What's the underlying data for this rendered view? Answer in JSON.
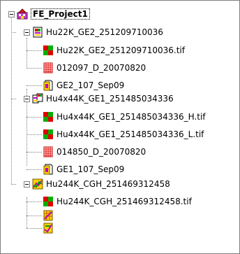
{
  "tree": {
    "root": {
      "label": "FE_Project1",
      "icon": "project-icon"
    },
    "groups": [
      {
        "label": "Hu22K_GE2_251209710036",
        "icon": "extraction-set-icon",
        "children": [
          {
            "label": "Hu22K_GE2_251209710036.tif",
            "icon": "image-file-icon"
          },
          {
            "label": "012097_D_20070820",
            "icon": "grid-template-icon"
          },
          {
            "label": "GE2_107_Sep09",
            "icon": "protocol-icon"
          }
        ]
      },
      {
        "label": "Hu4x44K_GE1_251485034336",
        "icon": "extraction-set-icon",
        "children": [
          {
            "label": "Hu4x44K_GE1_251485034336_H.tif",
            "icon": "image-file-icon"
          },
          {
            "label": "Hu4x44K_GE1_251485034336_L.tif",
            "icon": "image-file-icon"
          },
          {
            "label": "014850_D_20070820",
            "icon": "grid-template-icon"
          },
          {
            "label": "GE1_107_Sep09",
            "icon": "protocol-icon"
          }
        ]
      },
      {
        "label": "Hu244K_CGH_251469312458",
        "icon": "extraction-set-icon",
        "children": [
          {
            "label": "Hu244K_CGH_251469312458.tif",
            "icon": "image-file-icon"
          },
          {
            "label": "",
            "icon": "missing-grid-icon"
          },
          {
            "label": "",
            "icon": "missing-protocol-icon"
          }
        ]
      }
    ]
  }
}
